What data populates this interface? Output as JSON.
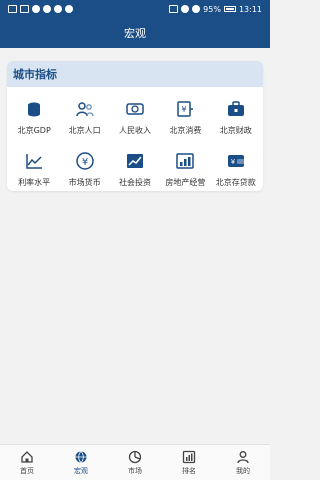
{
  "status_bar": {
    "left_icons": [
      "volte-icon",
      "signal-icon",
      "wifi-icon",
      "data-icon",
      "usb-icon",
      "message-icon"
    ],
    "battery": "95%",
    "time": "13:11"
  },
  "header": {
    "title": "宏观"
  },
  "city_indicators": {
    "title": "城市指标",
    "items": [
      {
        "label": "北京GDP",
        "icon": "coins-icon"
      },
      {
        "label": "北京人口",
        "icon": "people-icon"
      },
      {
        "label": "人民收入",
        "icon": "income-icon"
      },
      {
        "label": "北京消费",
        "icon": "consumption-icon"
      },
      {
        "label": "北京财政",
        "icon": "finance-icon"
      },
      {
        "label": "利率水平",
        "icon": "interest-chart-icon"
      },
      {
        "label": "市场货币",
        "icon": "yuan-circle-icon"
      },
      {
        "label": "社会投资",
        "icon": "investment-chart-icon"
      },
      {
        "label": "房地产经营",
        "icon": "real-estate-bar-icon"
      },
      {
        "label": "北京存贷款",
        "icon": "deposit-loan-icon"
      }
    ]
  },
  "bottom_nav": [
    {
      "label": "首页",
      "icon": "home-icon"
    },
    {
      "label": "宏观",
      "icon": "globe-icon",
      "active": true
    },
    {
      "label": "市场",
      "icon": "pie-icon"
    },
    {
      "label": "排名",
      "icon": "ranking-icon"
    },
    {
      "label": "我的",
      "icon": "user-icon"
    }
  ],
  "colors": {
    "primary": "#1b4e86",
    "section_bg": "#d9e4f2"
  }
}
